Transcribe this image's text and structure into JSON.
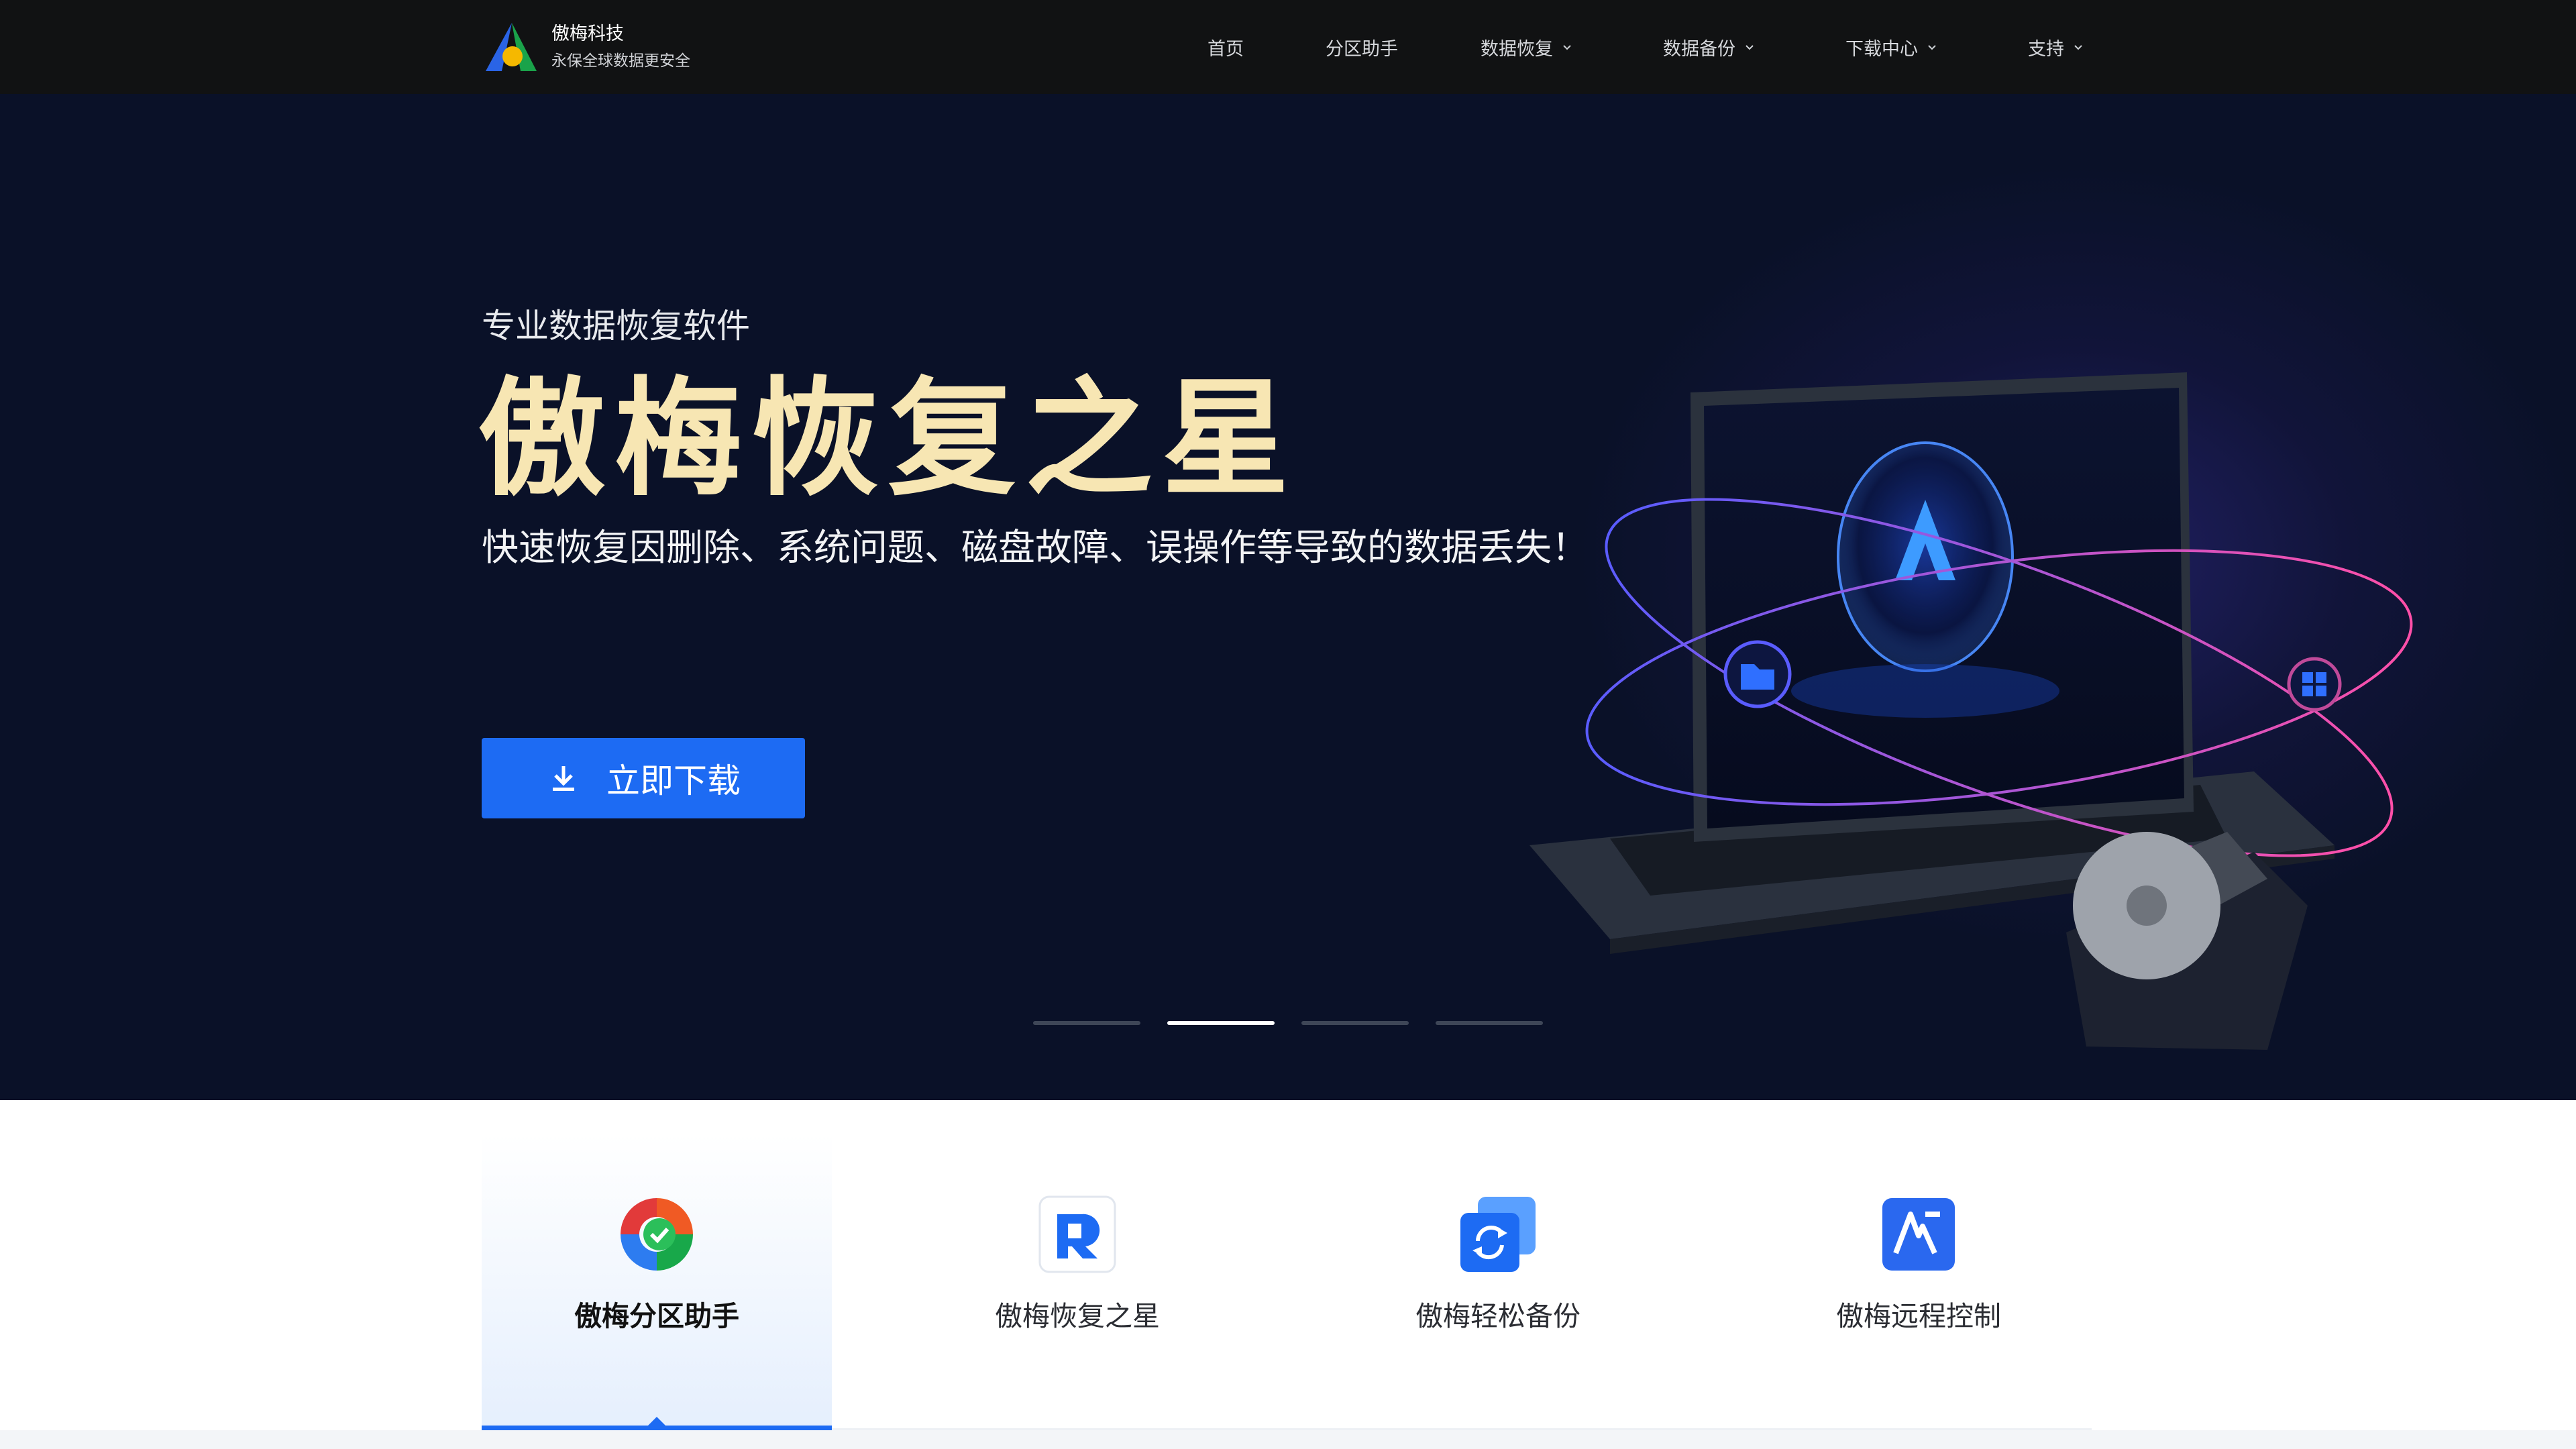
{
  "brand": {
    "name": "傲梅科技",
    "tagline": "永保全球数据更安全"
  },
  "nav": {
    "items": [
      {
        "label": "首页",
        "has_dropdown": false
      },
      {
        "label": "分区助手",
        "has_dropdown": false
      },
      {
        "label": "数据恢复",
        "has_dropdown": true
      },
      {
        "label": "数据备份",
        "has_dropdown": true
      },
      {
        "label": "下载中心",
        "has_dropdown": true
      },
      {
        "label": "支持",
        "has_dropdown": true
      }
    ]
  },
  "hero": {
    "eyebrow": "专业数据恢复软件",
    "title": "傲梅恢复之星",
    "description": "快速恢复因删除、系统问题、磁盘故障、误操作等导致的数据丢失！",
    "cta_label": "立即下载",
    "cta_icon": "download-icon",
    "slides": {
      "total": 4,
      "active": 2
    }
  },
  "products": {
    "tabs": [
      {
        "label": "傲梅分区助手",
        "icon": "partition-assistant-icon",
        "active": true
      },
      {
        "label": "傲梅恢复之星",
        "icon": "recovery-star-icon",
        "active": false
      },
      {
        "label": "傲梅轻松备份",
        "icon": "easy-backup-icon",
        "active": false
      },
      {
        "label": "傲梅远程控制",
        "icon": "remote-control-icon",
        "active": false
      }
    ]
  },
  "colors": {
    "nav_bg": "#111213",
    "hero_bg": "#0a1128",
    "title_gold": "#f7e6b3",
    "accent_blue": "#1d6bf3"
  }
}
